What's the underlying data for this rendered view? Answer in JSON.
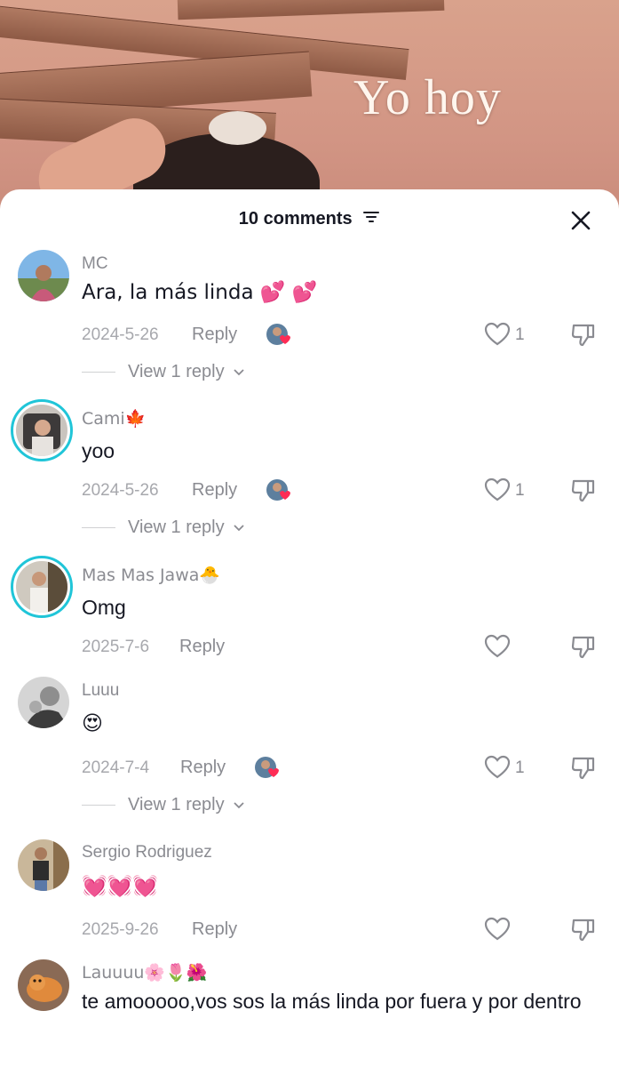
{
  "video": {
    "overlay_text": "Yo hoy"
  },
  "sheet": {
    "comment_count": "10 comments"
  },
  "comments": [
    {
      "user": "MC",
      "text": "Ara, la más linda 💕 💕",
      "date": "2024-5-26",
      "reply": "Reply",
      "likes": "1",
      "view_replies": "View 1 reply"
    },
    {
      "user": "Cami🍁",
      "text": "yoo",
      "date": "2024-5-26",
      "reply": "Reply",
      "likes": "1",
      "view_replies": "View 1 reply"
    },
    {
      "user": "Mas Mas Jawa🐣",
      "text": "Omg",
      "date": "2025-7-6",
      "reply": "Reply"
    },
    {
      "user": "Luuu",
      "text": "😍",
      "date": "2024-7-4",
      "reply": "Reply",
      "likes": "1",
      "view_replies": "View 1 reply"
    },
    {
      "user": "Sergio Rodriguez",
      "text": "💓💓💓",
      "date": "2025-9-26",
      "reply": "Reply"
    },
    {
      "user": "Lauuuu🌸🌷🌺",
      "text": "te amooooo,vos sos la más linda por fuera y por dentro"
    }
  ]
}
